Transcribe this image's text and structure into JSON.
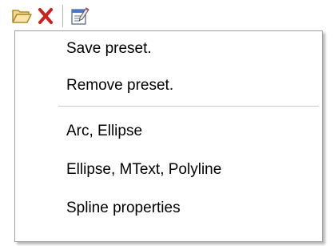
{
  "toolbar": {
    "buttons": [
      {
        "icon": "folder-open-icon"
      },
      {
        "icon": "delete-x-icon",
        "color": "#c8231e"
      },
      {
        "icon": "properties-icon"
      }
    ]
  },
  "menu": {
    "preset_actions": [
      {
        "label": "Save preset."
      },
      {
        "label": "Remove preset."
      }
    ],
    "presets": [
      {
        "label": "Arc, Ellipse"
      },
      {
        "label": "Ellipse, MText, Polyline"
      },
      {
        "label": "Spline properties"
      }
    ]
  }
}
